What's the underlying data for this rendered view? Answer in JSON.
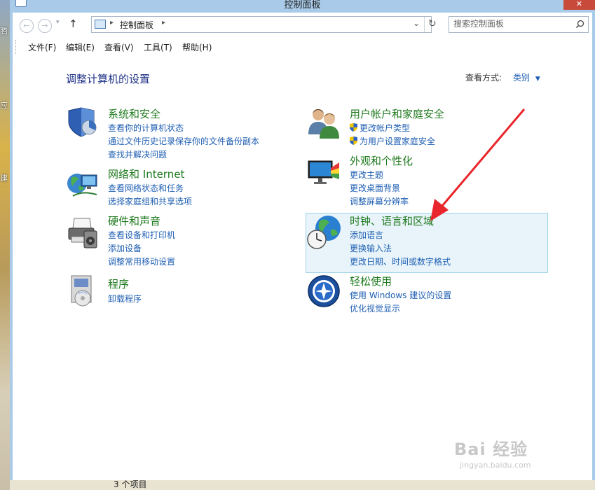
{
  "window": {
    "title": "控制面板",
    "close_symbol": "✕"
  },
  "desktop": {
    "glyphs": [
      "腾",
      "应",
      "建"
    ]
  },
  "navbar": {
    "back_symbol": "←",
    "forward_symbol": "→",
    "up_symbol": "↑",
    "refresh_symbol": "↻",
    "address": "控制面板",
    "search": {
      "placeholder": "搜索控制面板",
      "value": ""
    }
  },
  "menu": [
    {
      "label": "文件(F)"
    },
    {
      "label": "编辑(E)"
    },
    {
      "label": "查看(V)"
    },
    {
      "label": "工具(T)"
    },
    {
      "label": "帮助(H)"
    }
  ],
  "main": {
    "title": "调整计算机的设置",
    "view_by_label": "查看方式:",
    "view_by_value": "类别",
    "categories": [
      {
        "title": "系统和安全",
        "icon": "security-shield-icon",
        "links": [
          "查看你的计算机状态",
          "通过文件历史记录保存你的文件备份副本",
          "查找并解决问题"
        ]
      },
      {
        "title": "网络和 Internet",
        "icon": "network-globe-icon",
        "links": [
          "查看网络状态和任务",
          "选择家庭组和共享选项"
        ]
      },
      {
        "title": "硬件和声音",
        "icon": "printer-icon",
        "links": [
          "查看设备和打印机",
          "添加设备",
          "调整常用移动设置"
        ]
      },
      {
        "title": "程序",
        "icon": "programs-icon",
        "links": [
          "卸载程序"
        ]
      },
      {
        "title": "用户帐户和家庭安全",
        "icon": "users-icon",
        "links": [
          "更改帐户类型",
          "为用户设置家庭安全"
        ]
      },
      {
        "title": "外观和个性化",
        "icon": "monitor-icon",
        "links": [
          "更改主题",
          "更改桌面背景",
          "调整屏幕分辨率"
        ]
      },
      {
        "title": "时钟、语言和区域",
        "icon": "clock-globe-icon",
        "links": [
          "添加语言",
          "更换输入法",
          "更改日期、时间或数字格式"
        ]
      },
      {
        "title": "轻松使用",
        "icon": "ease-of-access-icon",
        "links": [
          "使用 Windows 建议的设置",
          "优化视觉显示"
        ]
      }
    ]
  },
  "status": {
    "text": "3 个项目"
  },
  "watermark": {
    "main": "Bai 经验",
    "sub": "jingyan.baidu.com"
  },
  "colors": {
    "link": "#1f5fb3",
    "category_title": "#1f7a1f",
    "heading": "#1e3287",
    "annotation_arrow": "#e8262b"
  }
}
